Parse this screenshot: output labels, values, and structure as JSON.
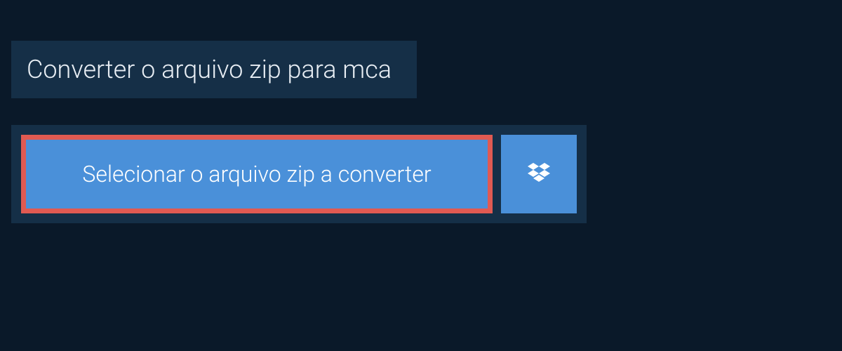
{
  "title": "Converter o arquivo zip para mca",
  "select_button_label": "Selecionar o arquivo zip a converter",
  "colors": {
    "background": "#0a1929",
    "panel": "#152f47",
    "button": "#4a90d9",
    "highlight_border": "#e05a52",
    "text_light": "#e8eef4"
  }
}
